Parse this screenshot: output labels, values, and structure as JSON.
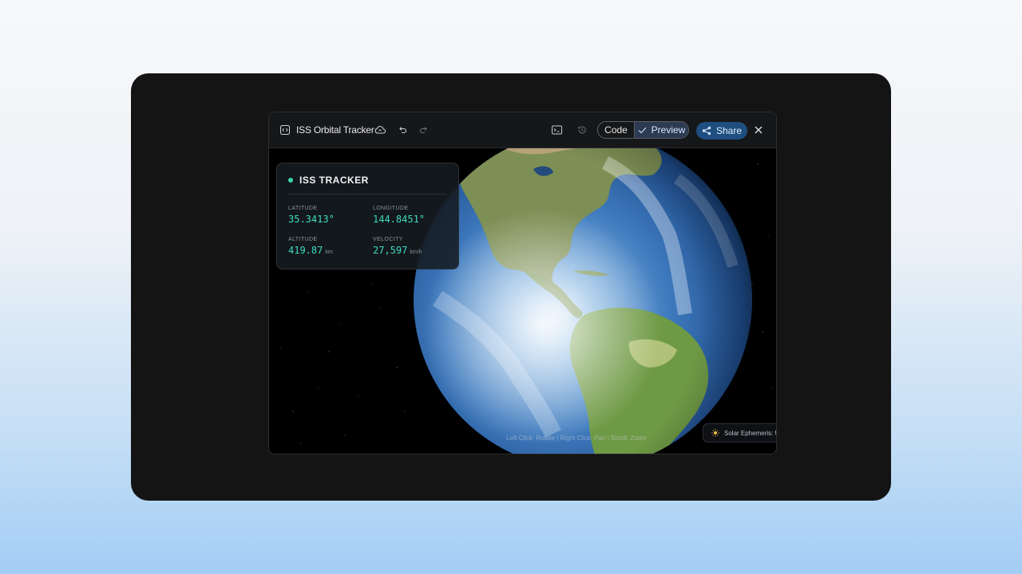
{
  "app": {
    "title": "ISS Orbital Tracker"
  },
  "toolbar": {
    "code_label": "Code",
    "preview_label": "Preview",
    "share_label": "Share"
  },
  "tracker": {
    "title": "ISS TRACKER",
    "latitude_label": "LATITUDE",
    "latitude_value": "35.3413°",
    "longitude_label": "LONGITUDE",
    "longitude_value": "144.8451°",
    "altitude_label": "ALTITUDE",
    "altitude_value": "419.87",
    "altitude_unit": "km",
    "velocity_label": "VELOCITY",
    "velocity_value": "27,597",
    "velocity_unit": "km/h"
  },
  "viewport": {
    "hint": "Left Click: Rotate | Right Click: Pan | Scroll: Zoom",
    "ephemeris": "Solar Ephemeris: U"
  },
  "colors": {
    "accent_teal": "#3fdcc1",
    "share_blue": "#1e4f80",
    "preview_active": "#2c3a52"
  },
  "icons": [
    "code-icon",
    "cloud-icon",
    "undo-icon",
    "redo-icon",
    "terminal-icon",
    "history-icon",
    "check-icon",
    "share-icon",
    "close-icon",
    "sun-icon"
  ]
}
